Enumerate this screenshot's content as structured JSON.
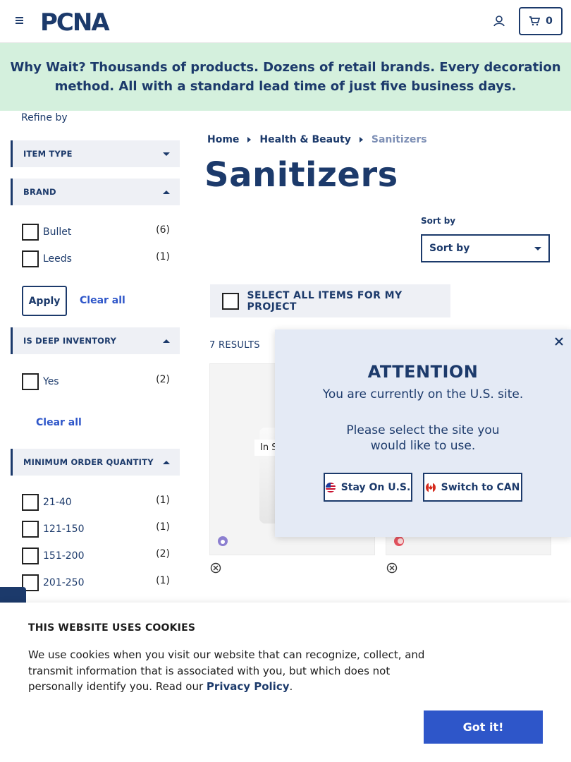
{
  "header": {
    "logo_text": "PCNA",
    "cart_count": "0"
  },
  "promo": {
    "text": "Why Wait? Thousands of products. Dozens of retail brands. Every decoration method. All with a standard lead time of just five business days."
  },
  "sidebar": {
    "refine_label": "Refine by",
    "facets": [
      {
        "label": "ITEM TYPE",
        "state": "collapsed"
      },
      {
        "label": "BRAND",
        "state": "expanded",
        "options": [
          {
            "name": "Bullet",
            "count": "(6)"
          },
          {
            "name": "Leeds",
            "count": "(1)"
          }
        ]
      },
      {
        "label": "IS DEEP INVENTORY",
        "state": "expanded",
        "options": [
          {
            "name": "Yes",
            "count": "(2)"
          }
        ]
      },
      {
        "label": "MINIMUM ORDER QUANTITY",
        "state": "expanded",
        "options": [
          {
            "name": "21-40",
            "count": "(1)"
          },
          {
            "name": "121-150",
            "count": "(1)"
          },
          {
            "name": "151-200",
            "count": "(2)"
          },
          {
            "name": "201-250",
            "count": "(1)"
          }
        ]
      }
    ],
    "apply_label": "Apply",
    "clear_all_label": "Clear all",
    "clear_all_label_2": "Clear all"
  },
  "breadcrumb": [
    "Home",
    "Health & Beauty",
    "Sanitizers"
  ],
  "page_title": "Sanitizers",
  "sort": {
    "label": "Sort by",
    "value": "Sort by"
  },
  "select_all_label": "SELECT ALL ITEMS FOR MY PROJECT",
  "results_label": "7 RESULTS",
  "products": [
    {
      "stock_badge": "In S",
      "brand_color": "#8c7fd0"
    },
    {
      "brand_color": "#e3535f"
    }
  ],
  "modal": {
    "title": "ATTENTION",
    "subtitle": "You are currently on the U.S. site.",
    "ask": "Please select the site you would like to use.",
    "stay_label": "Stay On U.S.",
    "switch_label": "Switch to CAN"
  },
  "cookie": {
    "title": "THIS WEBSITE USES COOKIES",
    "text": "We use cookies when you visit our website that can recognize, collect, and transmit information that is associated with you, but which does not personally identify you. Read our",
    "link": "Privacy Policy",
    "period": ".",
    "button": "Got it!"
  },
  "colors": {
    "navy": "#1c3a6b",
    "link_blue": "#2e56c9",
    "promo_bg": "#d4f0dd",
    "panel_bg": "#eef0f5",
    "modal_bg": "#e4eaf5"
  }
}
